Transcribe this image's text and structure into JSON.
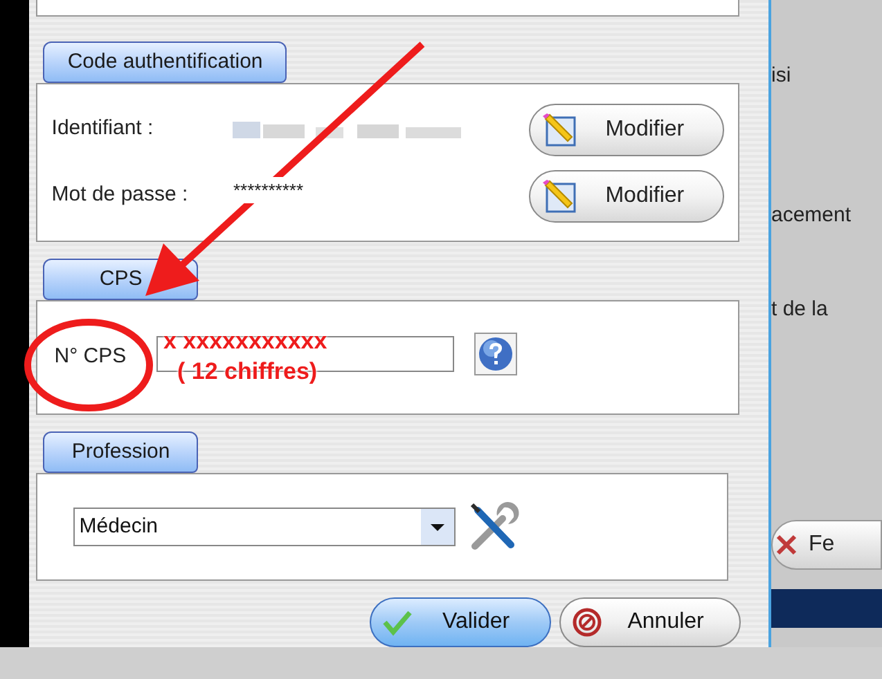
{
  "auth": {
    "title": "Code authentification",
    "rows": [
      {
        "label": "Identifiant :",
        "kind": "blurred",
        "button": "Modifier"
      },
      {
        "label": "Mot de passe :",
        "kind": "text",
        "value": "**********",
        "button": "Modifier"
      }
    ]
  },
  "cps": {
    "title": "CPS",
    "label": "N° CPS",
    "annotation": [
      "x xxxxxxxxxxx",
      "( 12 chiffres)"
    ]
  },
  "profession": {
    "title": "Profession",
    "value": "Médecin"
  },
  "buttons": [
    {
      "kind": "ok",
      "label": "Valider"
    },
    {
      "kind": "cancel",
      "label": "Annuler"
    }
  ],
  "background_window": {
    "texts": [
      "isi",
      "acement",
      "t de la"
    ],
    "button": "Fe"
  }
}
